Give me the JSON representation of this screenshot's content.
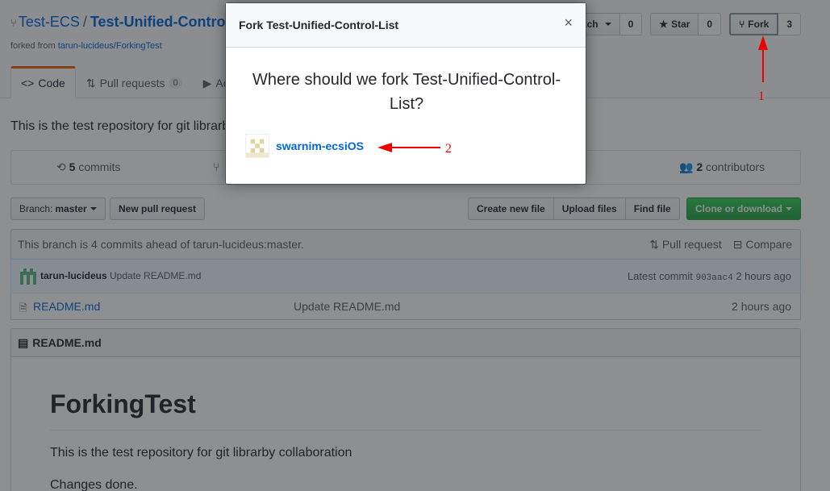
{
  "repo": {
    "owner": "Test-ECS",
    "separator": "/",
    "name": "Test-Unified-Control-List",
    "forked_prefix": "forked from",
    "forked_from": "tarun-lucideus/ForkingTest"
  },
  "actions": {
    "watch_label": "Watch",
    "watch_count": "0",
    "star_label": "Star",
    "star_count": "0",
    "fork_label": "Fork",
    "fork_count": "3"
  },
  "tabs": {
    "code": "Code",
    "pull_requests": "Pull requests",
    "pull_requests_count": "0",
    "actions": "Actions"
  },
  "description": "This is the test repository for git librarby collaboration",
  "numbers": {
    "commits_count": "5",
    "commits_label": "commits",
    "contributors_count": "2",
    "contributors_label": "contributors"
  },
  "filebar": {
    "branch_prefix": "Branch:",
    "branch_name": "master",
    "new_pr": "New pull request",
    "create_file": "Create new file",
    "upload_files": "Upload files",
    "find_file": "Find file",
    "clone": "Clone or download"
  },
  "branch_info": {
    "text": "This branch is 4 commits ahead of tarun-lucideus:master.",
    "pull_request": "Pull request",
    "compare": "Compare"
  },
  "commit": {
    "author": "tarun-lucideus",
    "message": "Update README.md",
    "latest_label": "Latest commit",
    "sha": "903aac4",
    "age": "2 hours ago"
  },
  "files": [
    {
      "name": "README.md",
      "message": "Update README.md",
      "age": "2 hours ago"
    }
  ],
  "readme": {
    "title": "README.md",
    "heading": "ForkingTest",
    "para1": "This is the test repository for git librarby collaboration",
    "para2": "Changes done."
  },
  "modal": {
    "title": "Fork Test-Unified-Control-List",
    "close": "×",
    "question": "Where should we fork Test-Unified-Control-List?",
    "target": "swarnim-ecsiOS"
  },
  "annotations": {
    "label_1": "1",
    "label_2": "2",
    "color": "#ee0000"
  },
  "colors": {
    "accent_tab": "#e36209",
    "link": "#0366d6",
    "clone_green": "#28a745"
  }
}
